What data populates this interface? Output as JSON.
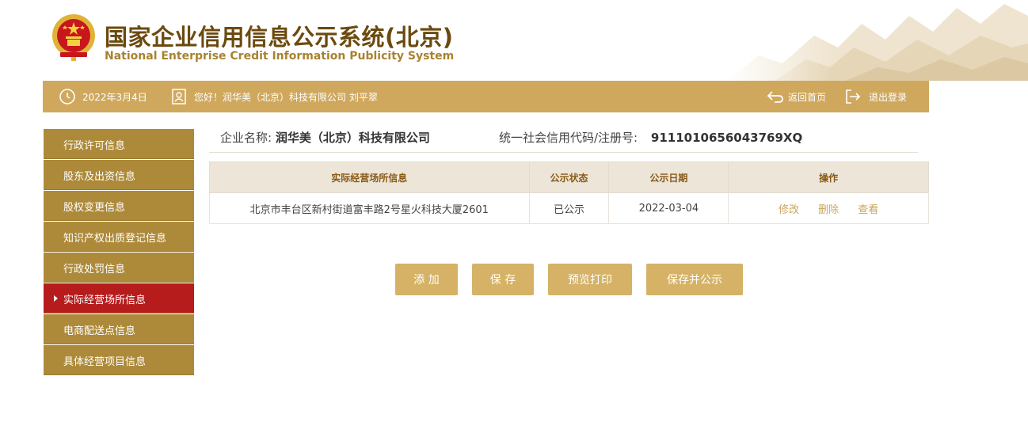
{
  "header": {
    "title_cn": "国家企业信用信息公示系统(北京)",
    "title_en": "National Enterprise Credit Information Publicity System"
  },
  "topbar": {
    "date": "2022年3月4日",
    "greeting": "您好！润华美（北京）科技有限公司 刘平翠",
    "home_label": "返回首页",
    "logout_label": "退出登录"
  },
  "sidebar": {
    "items": [
      {
        "label": "行政许可信息"
      },
      {
        "label": "股东及出资信息"
      },
      {
        "label": "股权变更信息"
      },
      {
        "label": "知识产权出质登记信息"
      },
      {
        "label": "行政处罚信息"
      },
      {
        "label": "实际经营场所信息",
        "active": true
      },
      {
        "label": "电商配送点信息"
      },
      {
        "label": "具体经营项目信息"
      }
    ]
  },
  "company": {
    "name_label": "企业名称:",
    "name_value": "润华美（北京）科技有限公司",
    "code_label": "统一社会信用代码/注册号:",
    "code_value": "9111010656043769XQ"
  },
  "table": {
    "headers": [
      "实际经营场所信息",
      "公示状态",
      "公示日期",
      "操作"
    ],
    "rows": [
      {
        "address": "北京市丰台区新村街道富丰路2号星火科技大厦2601",
        "status": "已公示",
        "date": "2022-03-04",
        "ops": [
          "修改",
          "删除",
          "查看"
        ]
      }
    ]
  },
  "buttons": {
    "add": "添 加",
    "save": "保 存",
    "preview": "预览打印",
    "save_publish": "保存并公示"
  },
  "colors": {
    "gold_bar": "#cfa85e",
    "sidebar": "#ad8a3a",
    "sidebar_active": "#b71c1c",
    "button": "#d5b266",
    "title": "#6b4a0f"
  }
}
